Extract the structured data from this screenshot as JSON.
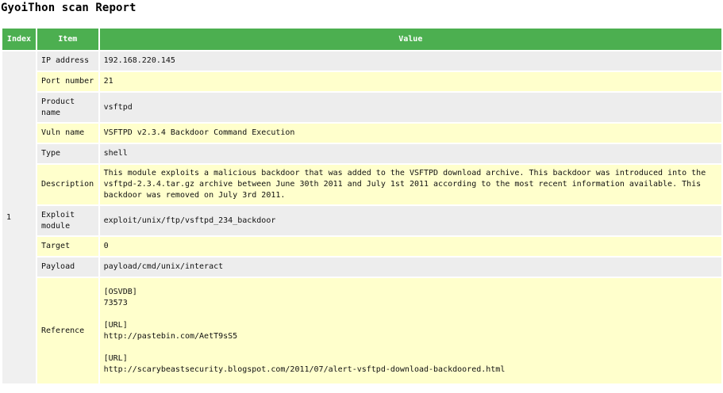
{
  "title": "GyoiThon scan Report",
  "colors": {
    "header_bg": "#4caf50",
    "header_text": "#ffffff",
    "row_grey": "#ededed",
    "row_yellow": "#ffffcc"
  },
  "table": {
    "headers": {
      "index": "Index",
      "item": "Item",
      "value": "Value"
    },
    "index_value": "1",
    "rows": [
      {
        "item": "IP address",
        "value": "192.168.220.145"
      },
      {
        "item": "Port number",
        "value": "21"
      },
      {
        "item": "Product name",
        "value": "vsftpd"
      },
      {
        "item": "Vuln name",
        "value": "VSFTPD v2.3.4 Backdoor Command Execution"
      },
      {
        "item": "Type",
        "value": "shell"
      },
      {
        "item": "Description",
        "value": "This module exploits a malicious backdoor that was added to the VSFTPD download archive. This backdoor was introduced into the vsftpd-2.3.4.tar.gz archive between June 30th 2011 and July 1st 2011 according to the most recent information available. This backdoor was removed on July 3rd 2011."
      },
      {
        "item": "Exploit module",
        "value": "exploit/unix/ftp/vsftpd_234_backdoor"
      },
      {
        "item": "Target",
        "value": "0"
      },
      {
        "item": "Payload",
        "value": "payload/cmd/unix/interact"
      },
      {
        "item": "Reference",
        "value": "[OSVDB]\n73573\n\n[URL]\nhttp://pastebin.com/AetT9sS5\n\n[URL]\nhttp://scarybeastsecurity.blogspot.com/2011/07/alert-vsftpd-download-backdoored.html"
      }
    ]
  }
}
